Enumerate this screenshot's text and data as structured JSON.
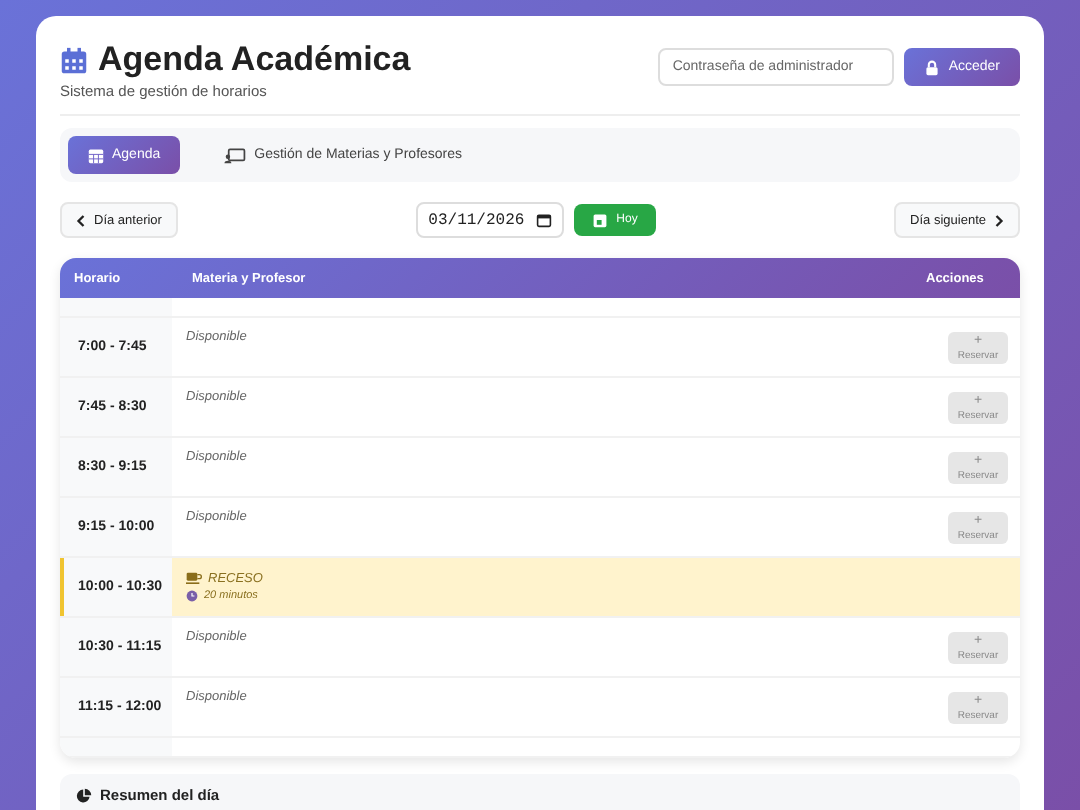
{
  "header": {
    "title": "Agenda Académica",
    "subtitle": "Sistema de gestión de horarios",
    "password": {
      "placeholder": "Contraseña de administrador"
    },
    "login_button": "Acceder"
  },
  "tabs": [
    {
      "label": "Agenda",
      "selected": true
    },
    {
      "label": "Gestión de Materias y Profesores",
      "selected": false
    }
  ],
  "nav": {
    "prev": "Día anterior",
    "date": "03/11/2026",
    "today": "Hoy",
    "next": "Día siguiente"
  },
  "table": {
    "columns": [
      "Horario",
      "Materia y Profesor",
      "Acciones"
    ],
    "rows": [
      {
        "kind": "slot",
        "time": "7:00 - 7:45",
        "subject": "Disponible",
        "action": {
          "icon": "+",
          "label": "Reservar",
          "disabled": true
        }
      },
      {
        "kind": "slot",
        "time": "7:45 - 8:30",
        "subject": "Disponible",
        "action": {
          "icon": "+",
          "label": "Reservar",
          "disabled": true
        }
      },
      {
        "kind": "slot",
        "time": "8:30 - 9:15",
        "subject": "Disponible",
        "action": {
          "icon": "+",
          "label": "Reservar",
          "disabled": true
        }
      },
      {
        "kind": "slot",
        "time": "9:15 - 10:00",
        "subject": "Disponible",
        "action": {
          "icon": "+",
          "label": "Reservar",
          "disabled": true
        }
      },
      {
        "kind": "break",
        "time": "10:00 - 10:30",
        "subject": "RECESO",
        "duration": "20 minutos"
      },
      {
        "kind": "slot",
        "time": "10:30 - 11:15",
        "subject": "Disponible",
        "action": {
          "icon": "+",
          "label": "Reservar",
          "disabled": true
        }
      },
      {
        "kind": "slot",
        "time": "11:15 - 12:00",
        "subject": "Disponible",
        "action": {
          "icon": "+",
          "label": "Reservar",
          "disabled": true
        }
      }
    ]
  },
  "summary": {
    "title": "Resumen del día"
  }
}
